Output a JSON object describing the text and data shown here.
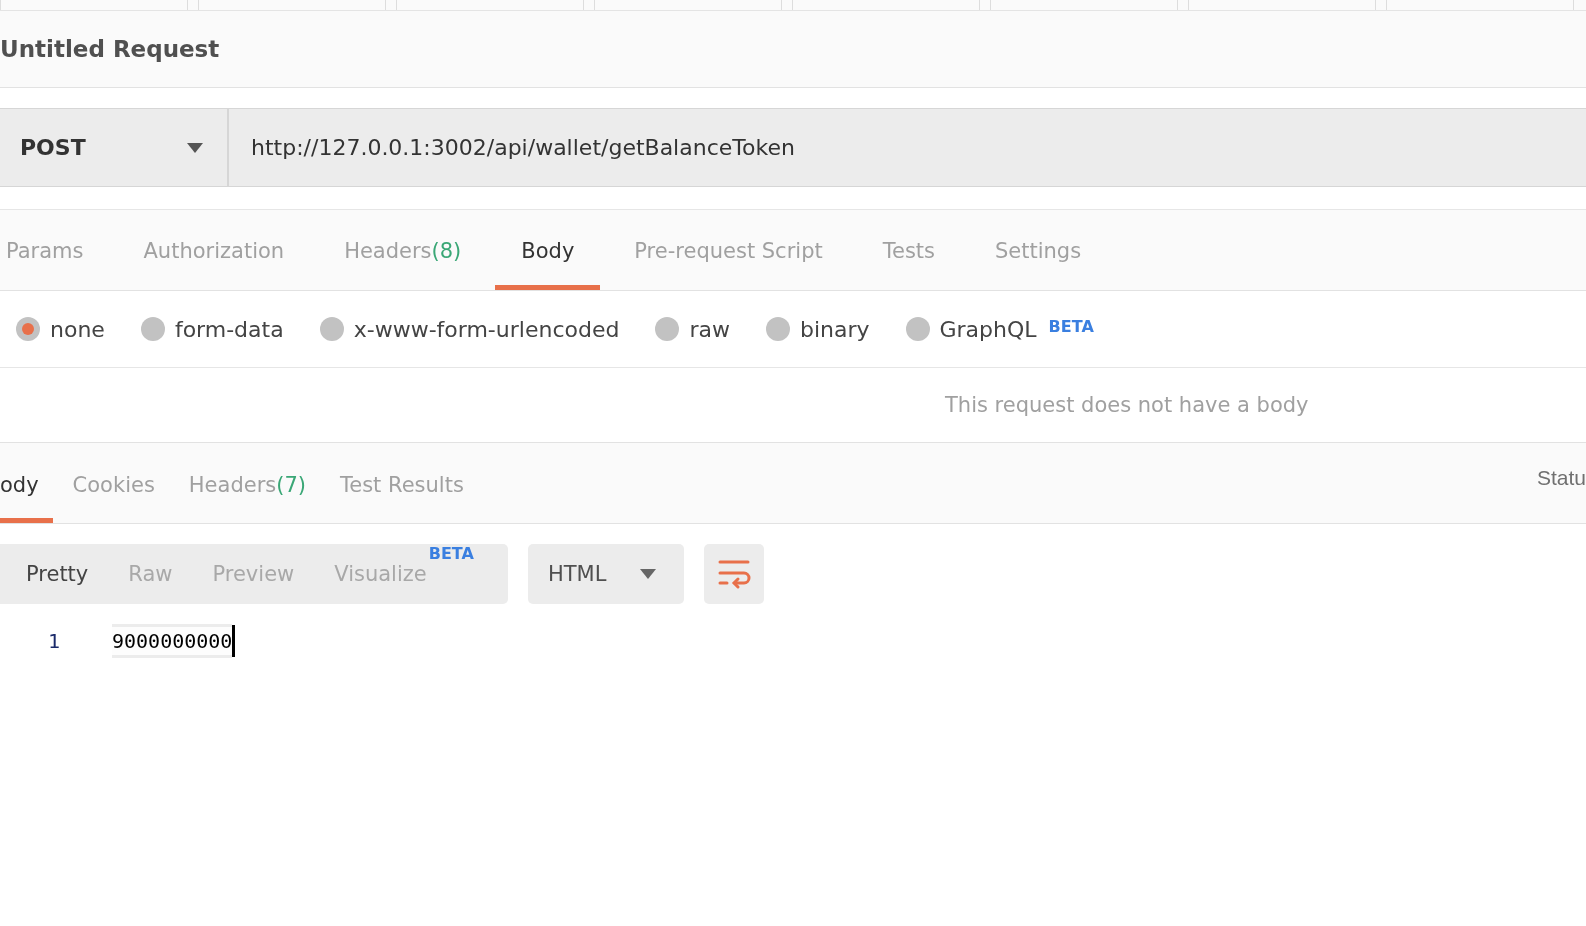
{
  "request": {
    "title": "Untitled Request",
    "method": "POST",
    "url": "http://127.0.0.1:3002/api/wallet/getBalanceToken"
  },
  "request_tabs": [
    {
      "label": "Params",
      "selected": false
    },
    {
      "label": "Authorization",
      "selected": false
    },
    {
      "label": "Headers",
      "count": "(8)",
      "selected": false
    },
    {
      "label": "Body",
      "selected": true
    },
    {
      "label": "Pre-request Script",
      "selected": false
    },
    {
      "label": "Tests",
      "selected": false
    },
    {
      "label": "Settings",
      "selected": false
    }
  ],
  "body_types": [
    {
      "label": "none",
      "selected": true
    },
    {
      "label": "form-data",
      "selected": false
    },
    {
      "label": "x-www-form-urlencoded",
      "selected": false
    },
    {
      "label": "raw",
      "selected": false
    },
    {
      "label": "binary",
      "selected": false
    },
    {
      "label": "GraphQL",
      "badge": "BETA",
      "selected": false
    }
  ],
  "body_message": "This request does not have a body",
  "response_tabs": [
    {
      "label": "ody",
      "selected": true
    },
    {
      "label": "Cookies",
      "selected": false
    },
    {
      "label": "Headers",
      "count": "(7)",
      "selected": false
    },
    {
      "label": "Test Results",
      "selected": false
    }
  ],
  "response_status": "Statu",
  "view_modes": [
    {
      "label": "Pretty",
      "selected": true
    },
    {
      "label": "Raw",
      "selected": false
    },
    {
      "label": "Preview",
      "selected": false
    },
    {
      "label": "Visualize",
      "badge": "BETA",
      "selected": false
    }
  ],
  "format": "HTML",
  "code_lines": [
    {
      "number": "1",
      "text": "9000000000"
    }
  ]
}
